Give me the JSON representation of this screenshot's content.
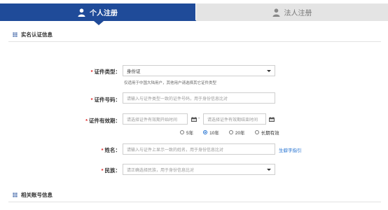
{
  "tabs": {
    "personal": "个人注册",
    "legal": "法人注册"
  },
  "sections": {
    "realname": "实名认证信息",
    "account": "相关账号信息"
  },
  "form": {
    "cert_type": {
      "label": "证件类型：",
      "value": "身份证",
      "hint": "仅适用于中国大陆用户，其他用户请选择其它证件类型"
    },
    "cert_no": {
      "label": "证件号码：",
      "placeholder": "请输入与证件类型一致的证件号码，用于身份信息比对"
    },
    "validity": {
      "label": "证件有效期：",
      "start_placeholder": "请选择证件有效期开始时间",
      "separator": "-",
      "end_placeholder": "请选择证件有效期结束时间",
      "options": [
        "5年",
        "10年",
        "20年",
        "长期有效"
      ],
      "selected": "10年"
    },
    "name": {
      "label": "姓名：",
      "placeholder": "请输入与证件上显示一致的姓名，用于身份信息比对",
      "rare_char_link": "生僻字指引"
    },
    "ethnic": {
      "label": "民族：",
      "placeholder": "请正确选择民族，用于身份信息比对"
    }
  },
  "required_mark": "*",
  "colors": {
    "primary": "#1f4b99",
    "required": "#e02020",
    "link": "#1f6fd0"
  }
}
